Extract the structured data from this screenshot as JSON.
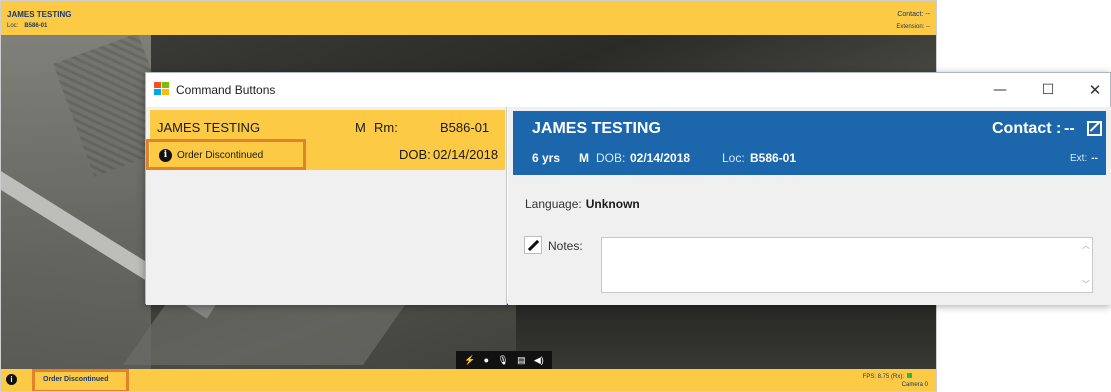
{
  "background_window": {
    "patient_name": "JAMES TESTING",
    "loc_label": "Loc:",
    "loc_value": "B586-01",
    "contact": "Contact:  --",
    "extension": "Extension:  --",
    "video_controls": [
      "flash-icon",
      "record-dot-icon",
      "microphone-icon",
      "chat-icon",
      "volume-icon"
    ],
    "footer": {
      "order_status": "Order Discontinued",
      "fps": "FPS: 8.75  (Rx):",
      "camera": "Camera 0"
    }
  },
  "dialog": {
    "title": "Command Buttons",
    "window_controls": {
      "minimize": "—",
      "maximize": "☐",
      "close": "✕"
    },
    "patient_card": {
      "name": "JAMES  TESTING",
      "sex": "M",
      "room_label": "Rm:",
      "room": "B586-01",
      "dob_label": "DOB:",
      "dob": "02/14/2018",
      "order_status": "Order Discontinued"
    },
    "detail": {
      "name": "JAMES  TESTING",
      "contact_label": "Contact :",
      "contact_value": "--",
      "age": "6 yrs",
      "sex": "M",
      "dob_label": "DOB:",
      "dob": "02/14/2018",
      "loc_label": "Loc:",
      "loc": "B586-01",
      "ext_label": "Ext:",
      "ext_value": "--",
      "language_label": "Language:",
      "language_value": "Unknown",
      "notes_label": "Notes:",
      "notes_value": ""
    }
  },
  "colors": {
    "banner_yellow": "#fcca44",
    "header_blue": "#1c67ab",
    "highlight_orange": "#e4822a"
  }
}
